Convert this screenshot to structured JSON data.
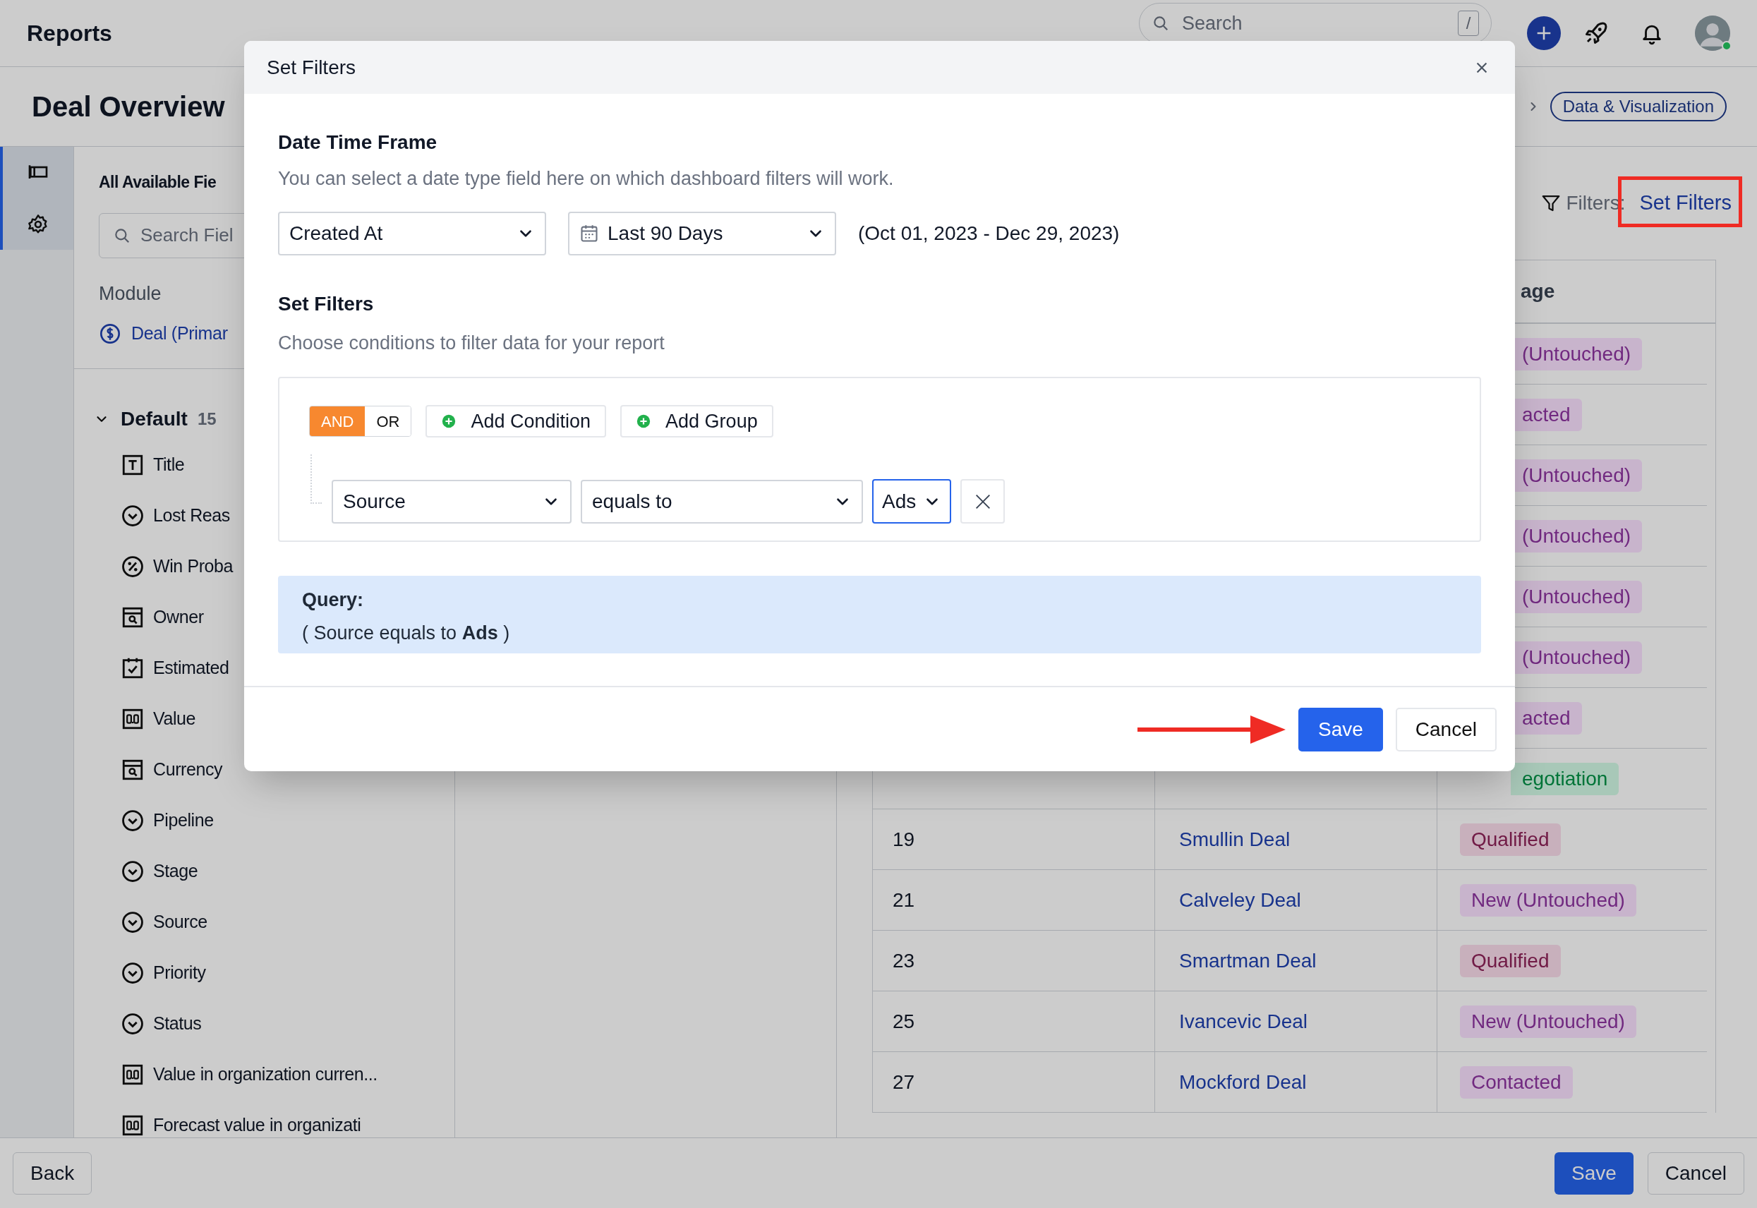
{
  "top_bar": {
    "title": "Reports",
    "search": {
      "placeholder": "Search",
      "shortcut": "/"
    }
  },
  "header": {
    "title": "Deal Overview",
    "breadcrumb": "Data & Visualization"
  },
  "fields_panel": {
    "title": "All Available Fie",
    "search_placeholder": "Search Fiel",
    "module_label": "Module",
    "module": "Deal (Primar",
    "group": {
      "label": "Default",
      "count": "15",
      "expanded": true,
      "items": [
        {
          "label": "Title",
          "kind": "text"
        },
        {
          "label": "Lost Reas",
          "kind": "select"
        },
        {
          "label": "Win Proba",
          "kind": "percent"
        },
        {
          "label": "Owner",
          "kind": "lookup"
        },
        {
          "label": "Estimated",
          "kind": "date"
        },
        {
          "label": "Value",
          "kind": "number"
        },
        {
          "label": "Currency",
          "kind": "lookup"
        },
        {
          "label": "Pipeline",
          "kind": "select"
        },
        {
          "label": "Stage",
          "kind": "select"
        },
        {
          "label": "Source",
          "kind": "select"
        },
        {
          "label": "Priority",
          "kind": "select"
        },
        {
          "label": "Status",
          "kind": "select"
        },
        {
          "label": "Value in organization curren...",
          "kind": "number"
        },
        {
          "label": "Forecast value in organizati",
          "kind": "number"
        }
      ]
    }
  },
  "filters_bar": {
    "label": "Filters:",
    "link": "Set Filters"
  },
  "table": {
    "header": "age",
    "rows": [
      {
        "stage": "(Untouched)",
        "color": "#c8b4cc",
        "partial": true
      },
      {
        "stage": "acted",
        "color": "#c8b4cc",
        "partial": true
      },
      {
        "stage": "(Untouched)",
        "color": "#c8b4cc",
        "partial": true
      },
      {
        "stage": "(Untouched)",
        "color": "#c8b4cc",
        "partial": true
      },
      {
        "stage": "(Untouched)",
        "color": "#c8b4cc",
        "partial": true
      },
      {
        "stage": "(Untouched)",
        "color": "#c8b4cc",
        "partial": true
      },
      {
        "stage": "acted",
        "color": "#c8b4cc",
        "partial": true
      },
      {
        "stage": "egotiation",
        "color": "#a8c9b8",
        "partial": true
      },
      {
        "id": "19",
        "deal": "Smullin Deal",
        "stage": "Qualified",
        "color": "#c8b0bc",
        "partial": false
      },
      {
        "id": "21",
        "deal": "Calveley Deal",
        "stage": "New (Untouched)",
        "color": "#c8b4cc",
        "partial": false
      },
      {
        "id": "23",
        "deal": "Smartman Deal",
        "stage": "Qualified",
        "color": "#c8b0bc",
        "partial": false
      },
      {
        "id": "25",
        "deal": "Ivancevic Deal",
        "stage": "New (Untouched)",
        "color": "#c8b4cc",
        "partial": false
      },
      {
        "id": "27",
        "deal": "Mockford Deal",
        "stage": "Contacted",
        "color": "#c8b4cc",
        "partial": false
      }
    ]
  },
  "footer": {
    "back": "Back",
    "save": "Save",
    "cancel": "Cancel"
  },
  "modal": {
    "title": "Set Filters",
    "date_section": {
      "title": "Date Time Frame",
      "description": "You can select a date type field here on which dashboard filters will work.",
      "field": "Created At",
      "range": "Last 90 Days",
      "dates": "(Oct 01, 2023 - Dec 29, 2023)"
    },
    "filter_section": {
      "title": "Set Filters",
      "description": "Choose conditions to filter data for your report",
      "logic": [
        {
          "label": "AND",
          "selected": true
        },
        {
          "label": "OR",
          "selected": false
        }
      ],
      "add_condition": "Add Condition",
      "add_group": "Add Group",
      "conditions": [
        {
          "field": "Source",
          "operator": "equals to",
          "value": "Ads",
          "focused": true
        }
      ]
    },
    "query": {
      "label": "Query:",
      "text": "( Source equals to **Ads** )"
    },
    "buttons": [
      {
        "label": "Save",
        "kind": "primary"
      },
      {
        "label": "Cancel",
        "kind": "secondary"
      }
    ]
  }
}
